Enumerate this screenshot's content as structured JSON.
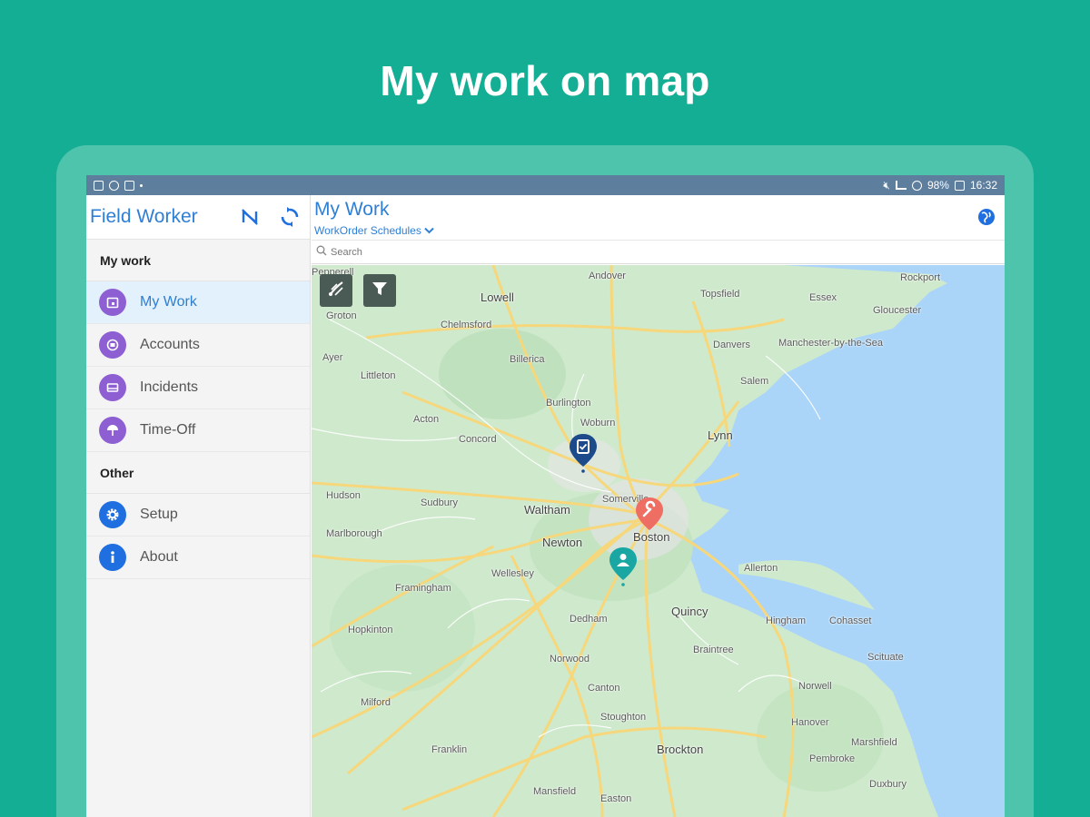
{
  "hero": {
    "title": "My work on map"
  },
  "status_bar": {
    "battery": "98%",
    "time": "16:32"
  },
  "sidebar": {
    "app_title": "Field Worker",
    "sections": [
      {
        "label": "My work"
      },
      {
        "label": "Other"
      }
    ],
    "items": [
      {
        "label": "My Work",
        "icon": "calendar-icon",
        "active": true
      },
      {
        "label": "Accounts",
        "icon": "accounts-icon"
      },
      {
        "label": "Incidents",
        "icon": "incidents-icon"
      },
      {
        "label": "Time-Off",
        "icon": "beach-umbrella-icon"
      },
      {
        "label": "Setup",
        "icon": "gear-icon"
      },
      {
        "label": "About",
        "icon": "info-icon"
      }
    ]
  },
  "main": {
    "title": "My Work",
    "view_selector": "WorkOrder Schedules",
    "search_placeholder": "Search"
  },
  "map": {
    "towns": [
      "Lowell",
      "Andover",
      "Pepperell",
      "Topsfield",
      "Rockport",
      "Essex",
      "Gloucester",
      "Groton",
      "Chelmsford",
      "Danvers",
      "Manchester-by-the-Sea",
      "Ayer",
      "Billerica",
      "Littleton",
      "Burlington",
      "Salem",
      "Acton",
      "Woburn",
      "Lynn",
      "Concord",
      "Hudson",
      "Sudbury",
      "Waltham",
      "Somerville",
      "Boston",
      "Marlborough",
      "Newton",
      "Wellesley",
      "Allerton",
      "Framingham",
      "Hopkinton",
      "Dedham",
      "Quincy",
      "Hingham",
      "Cohasset",
      "Norwood",
      "Braintree",
      "Scituate",
      "Canton",
      "Milford",
      "Stoughton",
      "Norwell",
      "Hanover",
      "Franklin",
      "Brockton",
      "Marshfield",
      "Pembroke",
      "Mansfield",
      "Easton",
      "Duxbury"
    ],
    "pins": [
      {
        "type": "work-order",
        "icon": "clipboard-icon",
        "color": "#1d4a8a"
      },
      {
        "type": "repair",
        "icon": "wrench-icon",
        "color": "#ee6e63"
      },
      {
        "type": "customer",
        "icon": "person-icon",
        "color": "#1aa6a2"
      }
    ],
    "colors": {
      "land": "#cfe9cd",
      "water": "#aad5f8",
      "road": "#f6d77b"
    }
  }
}
